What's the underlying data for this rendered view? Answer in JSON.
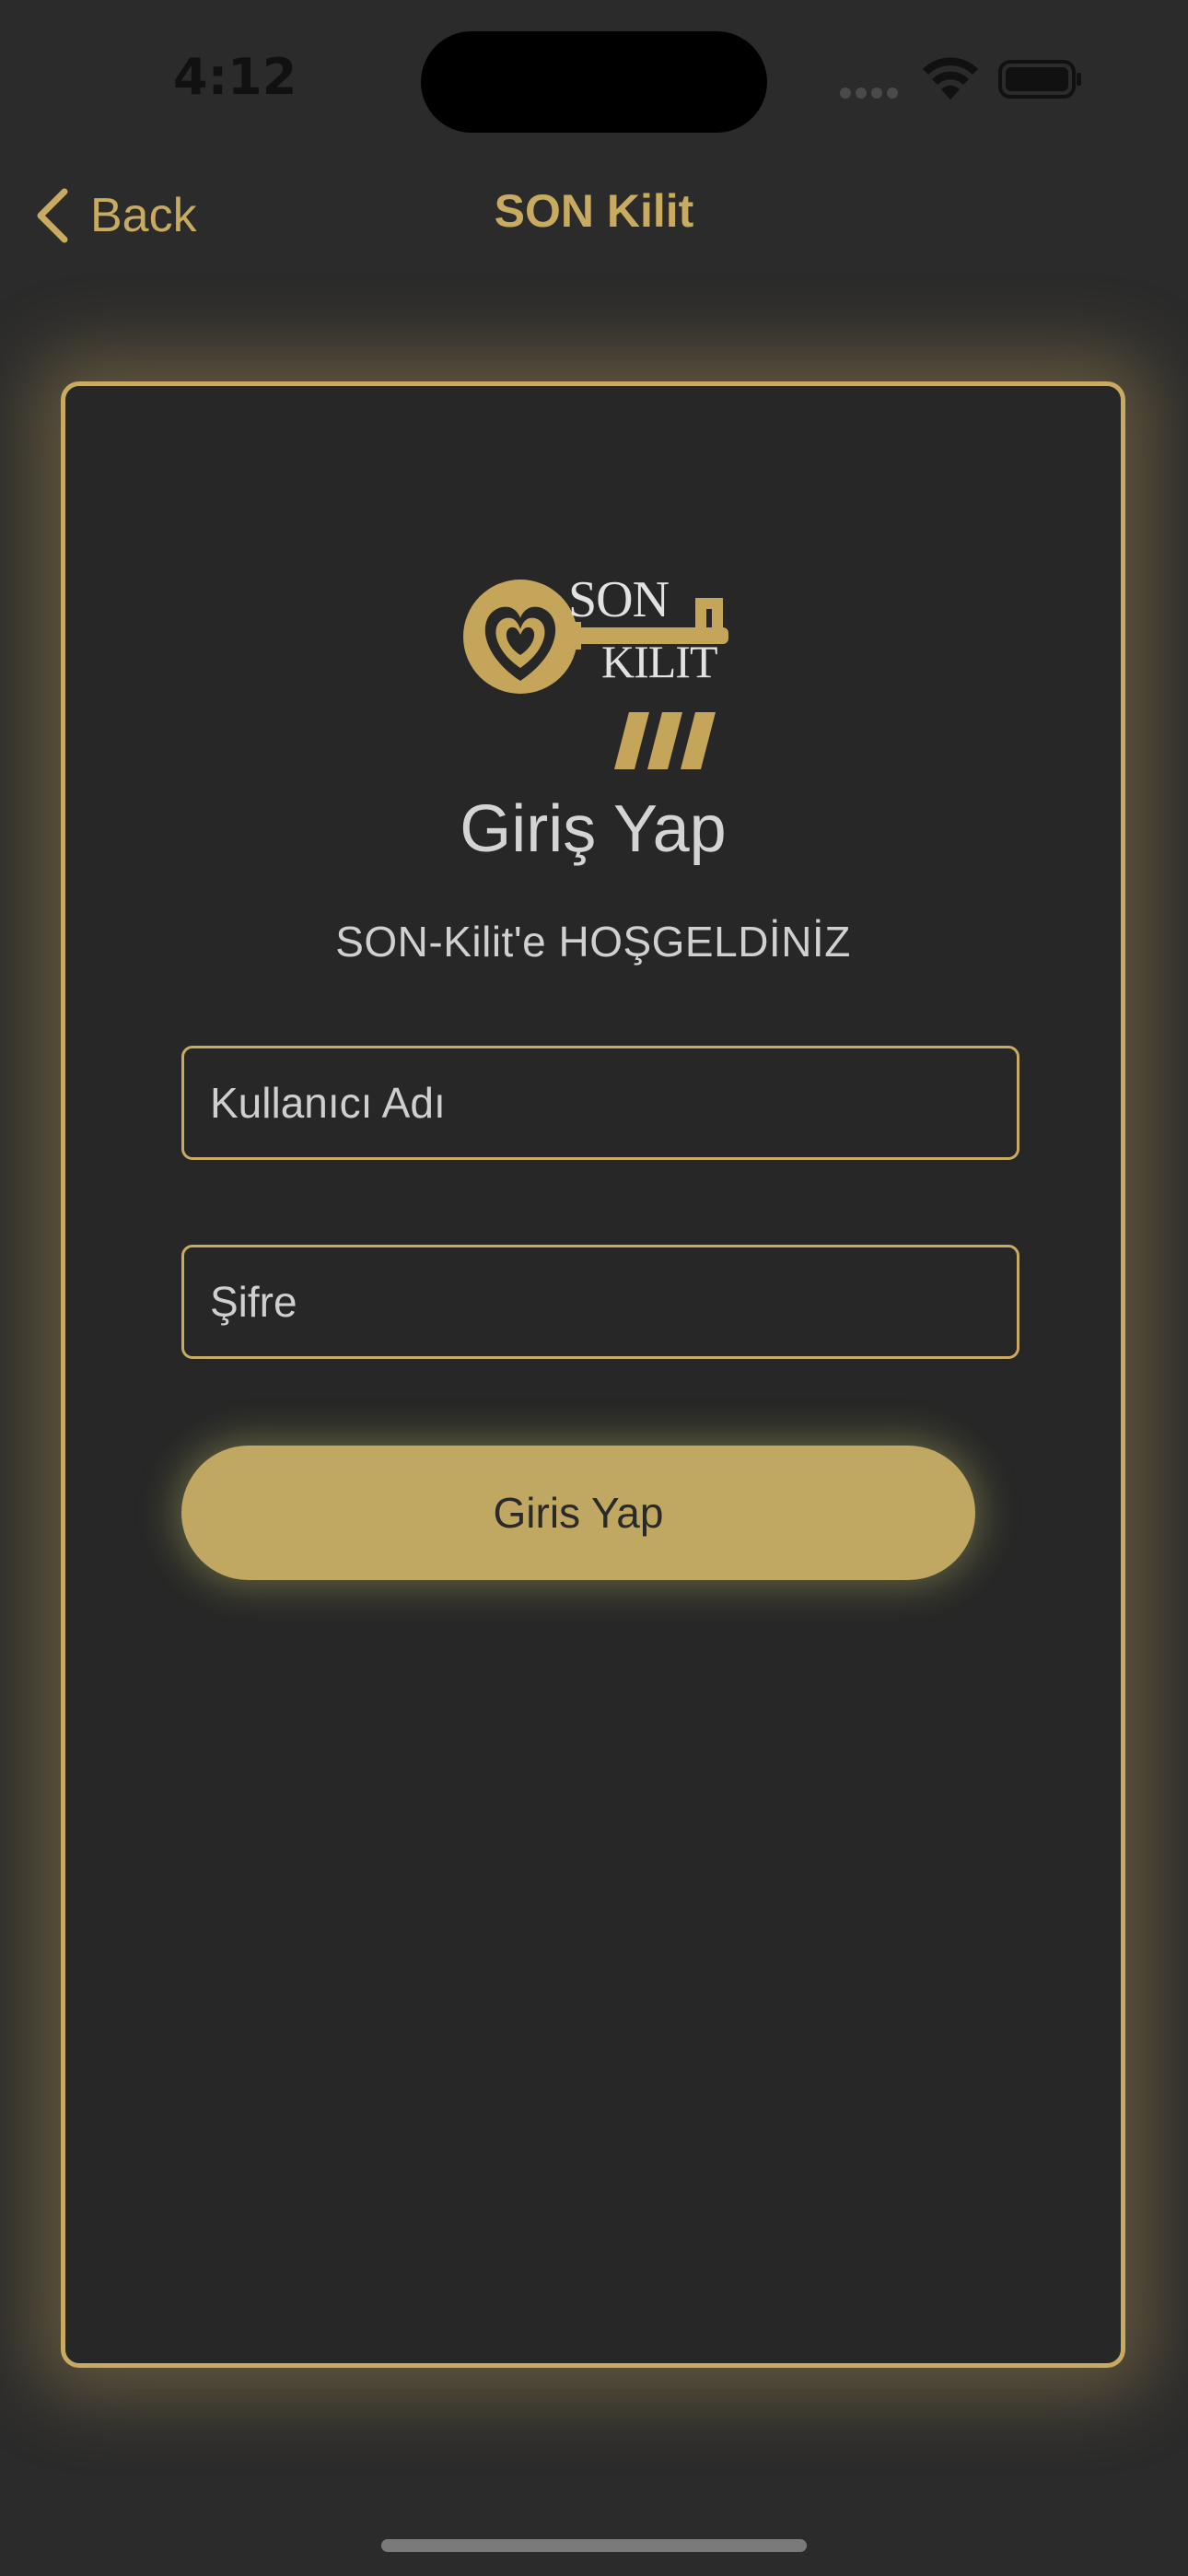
{
  "status_bar": {
    "time": "4:12"
  },
  "nav": {
    "back_label": "Back",
    "title": "SON Kilit"
  },
  "logo": {
    "line1": "SON",
    "line2": "KILIT"
  },
  "login": {
    "heading": "Giriş Yap",
    "welcome": "SON-Kilit'e HOŞGELDİNİZ",
    "username_placeholder": "Kullanıcı Adı",
    "password_placeholder": "Şifre",
    "submit_label": "Giris Yap"
  },
  "colors": {
    "accent": "#c8aa60",
    "button": "#c0a862",
    "background": "#2b2b2b",
    "card": "#272727"
  },
  "icons": {
    "back": "chevron-left-icon",
    "wifi": "wifi-icon",
    "battery": "battery-icon",
    "signal": "signal-icon"
  }
}
